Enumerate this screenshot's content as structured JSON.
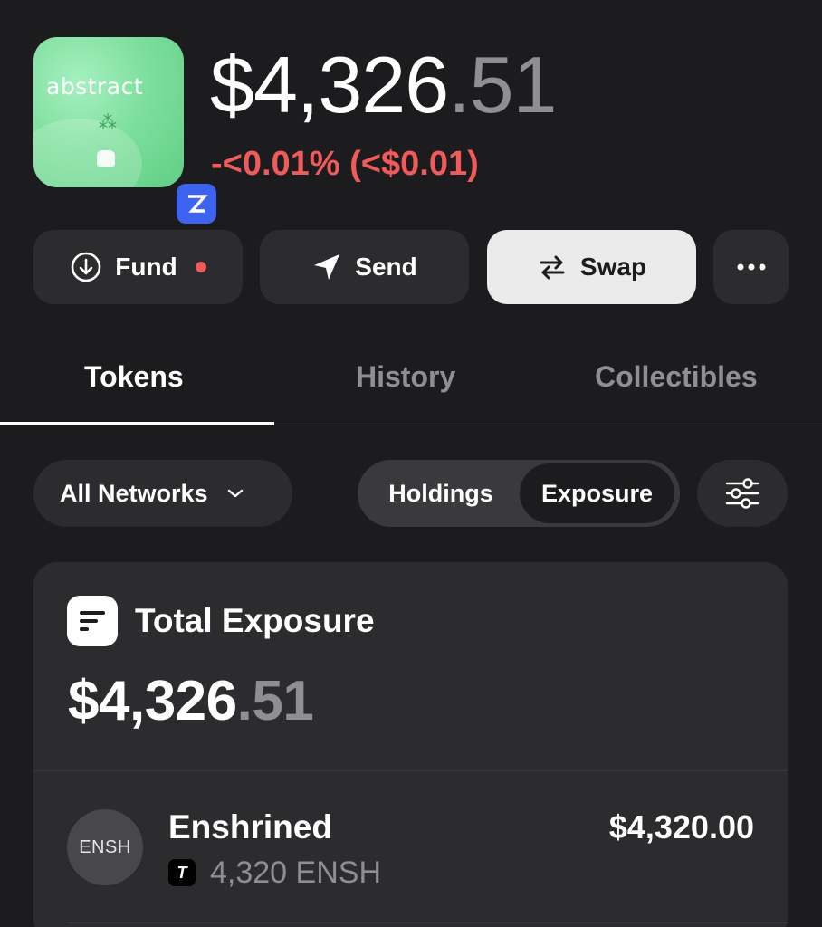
{
  "wallet": {
    "avatar_text": "abstract",
    "balance_main": "$4,326",
    "balance_cents": ".51",
    "change": "-<0.01% (<$0.01)",
    "colors": {
      "negative": "#ef5a5a",
      "badge": "#3d63f0"
    }
  },
  "actions": {
    "fund": "Fund",
    "send": "Send",
    "swap": "Swap",
    "more_icon": "more-horizontal-icon"
  },
  "tabs": [
    {
      "label": "Tokens",
      "active": true
    },
    {
      "label": "History",
      "active": false
    },
    {
      "label": "Collectibles",
      "active": false
    }
  ],
  "filters": {
    "network": "All Networks",
    "segment_options": [
      "Holdings",
      "Exposure"
    ],
    "segment_selected": "Exposure"
  },
  "exposure_card": {
    "title": "Total Exposure",
    "total_main": "$4,326",
    "total_cents": ".51",
    "tokens": [
      {
        "avatar": "ENSH",
        "name": "Enshrined",
        "chain_icon": "T",
        "amount": "4,320 ENSH",
        "value": "$4,320.00"
      }
    ]
  }
}
